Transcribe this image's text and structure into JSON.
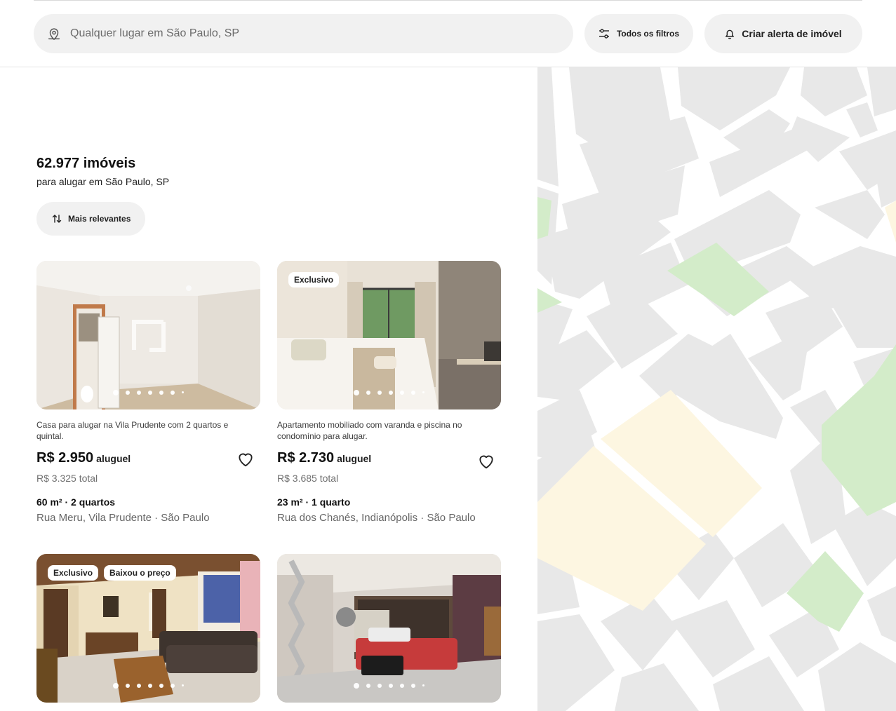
{
  "header": {
    "search_placeholder": "Qualquer lugar em São Paulo, SP",
    "filters_label": "Todos os filtros",
    "alert_label": "Criar alerta de imóvel"
  },
  "results": {
    "count": "62.977 imóveis",
    "subtitle": "para alugar em São Paulo, SP",
    "sort_label": "Mais relevantes"
  },
  "listings": [
    {
      "badges": [],
      "description": "Casa para alugar na Vila Prudente com 2 quartos e quintal.",
      "price": "R$ 2.950",
      "price_unit": "aluguel",
      "total": "R$ 3.325 total",
      "specs": "60 m² · 2 quartos",
      "address": "Rua Meru, Vila Prudente · São Paulo"
    },
    {
      "badges": [
        "Exclusivo"
      ],
      "description": "Apartamento mobiliado com varanda e piscina no condomínio para alugar.",
      "price": "R$ 2.730",
      "price_unit": "aluguel",
      "total": "R$ 3.685 total",
      "specs": "23 m² · 1 quarto",
      "address": "Rua dos Chanés, Indianópolis · São Paulo"
    },
    {
      "badges": [
        "Exclusivo",
        "Baixou o preço"
      ]
    },
    {
      "badges": []
    }
  ],
  "colors": {
    "pill_bg": "#f1f1f1",
    "map_block": "#e8e8e8",
    "map_park": "#d3ecc9",
    "map_sand": "#fdf6e1"
  },
  "icons": {
    "search": "map-pin-icon",
    "filters": "sliders-icon",
    "alert": "bell-icon",
    "sort": "sort-arrows-icon",
    "favorite": "heart-icon"
  }
}
